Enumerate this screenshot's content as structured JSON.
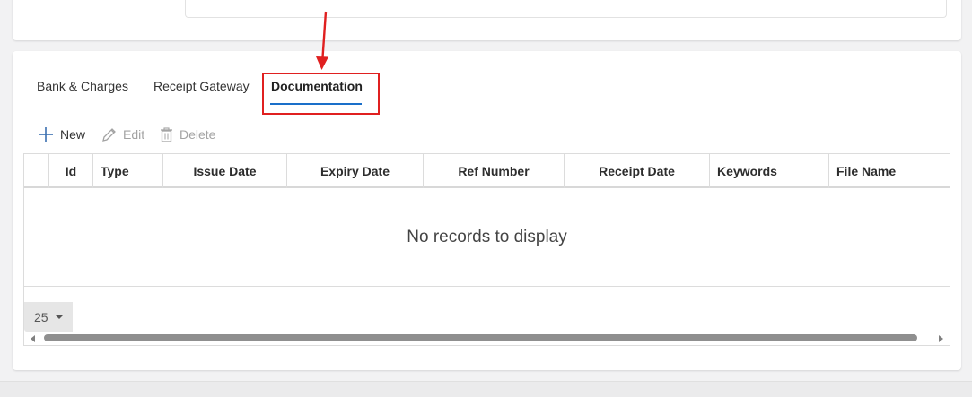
{
  "tabs": [
    {
      "label": "Bank & Charges",
      "active": false
    },
    {
      "label": "Receipt Gateway",
      "active": false
    },
    {
      "label": "Documentation",
      "active": true
    }
  ],
  "toolbar": {
    "new_label": "New",
    "edit_label": "Edit",
    "delete_label": "Delete"
  },
  "grid": {
    "columns": [
      "",
      "Id",
      "Type",
      "Issue Date",
      "Expiry Date",
      "Ref Number",
      "Receipt Date",
      "Keywords",
      "File Name"
    ],
    "empty_text": "No records to display",
    "page_size": "25"
  },
  "colors": {
    "accent": "#1a6fc9",
    "annotation": "#e02020"
  },
  "icons": [
    "plus-icon",
    "pencil-icon",
    "trash-icon",
    "caret-down-icon"
  ]
}
